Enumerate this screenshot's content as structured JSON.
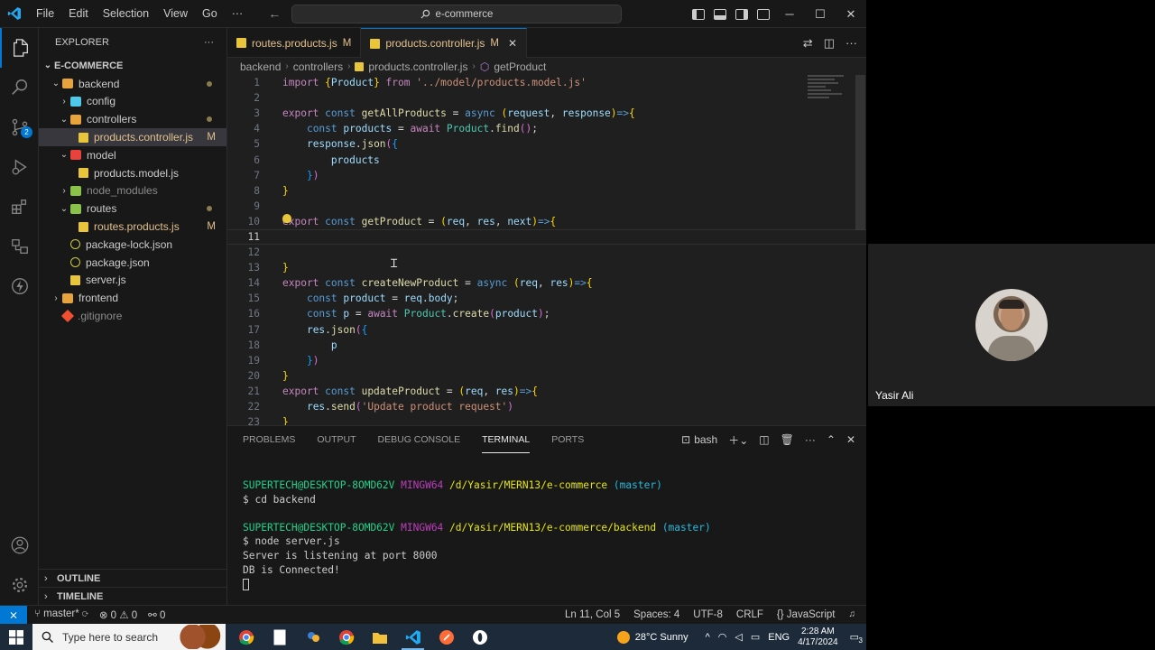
{
  "titlebar": {
    "menu": [
      "File",
      "Edit",
      "Selection",
      "View",
      "Go",
      "···"
    ],
    "search": "e-commerce",
    "back": "←",
    "forward": "→",
    "minimize": "─",
    "maximize": "☐",
    "close": "✕"
  },
  "activitybar": {
    "items": [
      "explorer-icon",
      "search-icon",
      "source-control-icon",
      "run-debug-icon",
      "extensions-icon",
      "remote-explorer-icon",
      "thunder-client-icon"
    ],
    "scm_badge": "2"
  },
  "explorer": {
    "title": "EXPLORER",
    "more": "···",
    "root": "E-COMMERCE",
    "tree": [
      {
        "label": "backend",
        "indent": 1,
        "type": "folder-open",
        "color": "#e8a33d",
        "dot": true
      },
      {
        "label": "config",
        "indent": 2,
        "type": "folder",
        "color": "#4ec9e9"
      },
      {
        "label": "controllers",
        "indent": 2,
        "type": "folder-open",
        "color": "#e8a33d",
        "dot": true
      },
      {
        "label": "products.controller.js",
        "indent": 3,
        "type": "js",
        "status": "M",
        "selected": true
      },
      {
        "label": "model",
        "indent": 2,
        "type": "folder-open",
        "color": "#e8423d"
      },
      {
        "label": "products.model.js",
        "indent": 3,
        "type": "js"
      },
      {
        "label": "node_modules",
        "indent": 2,
        "type": "folder",
        "color": "#8bc34a",
        "dim": true
      },
      {
        "label": "routes",
        "indent": 2,
        "type": "folder-open",
        "color": "#8bc34a",
        "dot": true
      },
      {
        "label": "routes.products.js",
        "indent": 3,
        "type": "js",
        "status": "M"
      },
      {
        "label": "package-lock.json",
        "indent": 2,
        "type": "json"
      },
      {
        "label": "package.json",
        "indent": 2,
        "type": "json"
      },
      {
        "label": "server.js",
        "indent": 2,
        "type": "js"
      },
      {
        "label": "frontend",
        "indent": 1,
        "type": "folder",
        "color": "#e8a33d"
      },
      {
        "label": ".gitignore",
        "indent": 1,
        "type": "git"
      }
    ],
    "outline": "OUTLINE",
    "timeline": "TIMELINE"
  },
  "tabs": [
    {
      "label": "routes.products.js",
      "status": "M",
      "active": false
    },
    {
      "label": "products.controller.js",
      "status": "M",
      "active": true,
      "close": "✕"
    }
  ],
  "breadcrumb": [
    "backend",
    "controllers",
    "products.controller.js",
    "getProduct"
  ],
  "code": {
    "current_line": 11,
    "lines": [
      [
        [
          "kw-ctrl",
          "import "
        ],
        [
          "br1",
          "{"
        ],
        [
          "var",
          "Product"
        ],
        [
          "br1",
          "}"
        ],
        [
          "ctrl",
          " from "
        ],
        [
          "str",
          "'../model/products.model.js'"
        ]
      ],
      [],
      [
        [
          "ctrl",
          "export "
        ],
        [
          "kw",
          "const "
        ],
        [
          "fn",
          "getAllProducts"
        ],
        [
          "pun",
          " = "
        ],
        [
          "kw",
          "async "
        ],
        [
          "br1",
          "("
        ],
        [
          "var",
          "request"
        ],
        [
          "pun",
          ", "
        ],
        [
          "var",
          "response"
        ],
        [
          "br1",
          ")"
        ],
        [
          "arrow",
          "=>"
        ],
        [
          "br1",
          "{"
        ]
      ],
      [
        [
          "pun",
          "    "
        ],
        [
          "kw",
          "const "
        ],
        [
          "var",
          "products"
        ],
        [
          "pun",
          " = "
        ],
        [
          "ctrl",
          "await "
        ],
        [
          "cls",
          "Product"
        ],
        [
          "pun",
          "."
        ],
        [
          "fn",
          "find"
        ],
        [
          "br2",
          "()"
        ],
        [
          "pun",
          ";"
        ]
      ],
      [
        [
          "pun",
          "    "
        ],
        [
          "var",
          "response"
        ],
        [
          "pun",
          "."
        ],
        [
          "fn",
          "json"
        ],
        [
          "br2",
          "("
        ],
        [
          "br3",
          "{"
        ]
      ],
      [
        [
          "pun",
          "        "
        ],
        [
          "var",
          "products"
        ]
      ],
      [
        [
          "pun",
          "    "
        ],
        [
          "br3",
          "}"
        ],
        [
          "br2",
          ")"
        ]
      ],
      [
        [
          "br1",
          "}"
        ]
      ],
      [],
      [
        [
          "ctrl",
          "export "
        ],
        [
          "kw",
          "const "
        ],
        [
          "fn",
          "getProduct"
        ],
        [
          "pun",
          " = "
        ],
        [
          "br1",
          "("
        ],
        [
          "var",
          "req"
        ],
        [
          "pun",
          ", "
        ],
        [
          "var",
          "res"
        ],
        [
          "pun",
          ", "
        ],
        [
          "var",
          "next"
        ],
        [
          "br1",
          ")"
        ],
        [
          "arrow",
          "=>"
        ],
        [
          "br1",
          "{"
        ]
      ],
      [],
      [],
      [
        [
          "br1",
          "}"
        ]
      ],
      [
        [
          "ctrl",
          "export "
        ],
        [
          "kw",
          "const "
        ],
        [
          "fn",
          "createNewProduct"
        ],
        [
          "pun",
          " = "
        ],
        [
          "kw",
          "async "
        ],
        [
          "br1",
          "("
        ],
        [
          "var",
          "req"
        ],
        [
          "pun",
          ", "
        ],
        [
          "var",
          "res"
        ],
        [
          "br1",
          ")"
        ],
        [
          "arrow",
          "=>"
        ],
        [
          "br1",
          "{"
        ]
      ],
      [
        [
          "pun",
          "    "
        ],
        [
          "kw",
          "const "
        ],
        [
          "var",
          "product"
        ],
        [
          "pun",
          " = "
        ],
        [
          "var",
          "req"
        ],
        [
          "pun",
          "."
        ],
        [
          "var",
          "body"
        ],
        [
          "pun",
          ";"
        ]
      ],
      [
        [
          "pun",
          "    "
        ],
        [
          "kw",
          "const "
        ],
        [
          "var",
          "p"
        ],
        [
          "pun",
          " = "
        ],
        [
          "ctrl",
          "await "
        ],
        [
          "cls",
          "Product"
        ],
        [
          "pun",
          "."
        ],
        [
          "fn",
          "create"
        ],
        [
          "br2",
          "("
        ],
        [
          "var",
          "product"
        ],
        [
          "br2",
          ")"
        ],
        [
          "pun",
          ";"
        ]
      ],
      [
        [
          "pun",
          "    "
        ],
        [
          "var",
          "res"
        ],
        [
          "pun",
          "."
        ],
        [
          "fn",
          "json"
        ],
        [
          "br2",
          "("
        ],
        [
          "br3",
          "{"
        ]
      ],
      [
        [
          "pun",
          "        "
        ],
        [
          "var",
          "p"
        ]
      ],
      [
        [
          "pun",
          "    "
        ],
        [
          "br3",
          "}"
        ],
        [
          "br2",
          ")"
        ]
      ],
      [
        [
          "br1",
          "}"
        ]
      ],
      [
        [
          "ctrl",
          "export "
        ],
        [
          "kw",
          "const "
        ],
        [
          "fn",
          "updateProduct"
        ],
        [
          "pun",
          " = "
        ],
        [
          "br1",
          "("
        ],
        [
          "var",
          "req"
        ],
        [
          "pun",
          ", "
        ],
        [
          "var",
          "res"
        ],
        [
          "br1",
          ")"
        ],
        [
          "arrow",
          "=>"
        ],
        [
          "br1",
          "{"
        ]
      ],
      [
        [
          "pun",
          "    "
        ],
        [
          "var",
          "res"
        ],
        [
          "pun",
          "."
        ],
        [
          "fn",
          "send"
        ],
        [
          "br2",
          "("
        ],
        [
          "str",
          "'Update product request'"
        ],
        [
          "br2",
          ")"
        ]
      ],
      [
        [
          "br1",
          "}"
        ]
      ]
    ]
  },
  "panel": {
    "tabs": [
      "PROBLEMS",
      "OUTPUT",
      "DEBUG CONSOLE",
      "TERMINAL",
      "PORTS"
    ],
    "active_tab": "TERMINAL",
    "shell": "bash",
    "terminal": [
      {
        "user": "SUPERTECH@DESKTOP-8OMD62V",
        "host": "MINGW64",
        "path": "/d/Yasir/MERN13/e-commerce",
        "branch": "(master)"
      },
      {
        "cmd": "$ cd backend"
      },
      {
        "blank": true
      },
      {
        "user": "SUPERTECH@DESKTOP-8OMD62V",
        "host": "MINGW64",
        "path": "/d/Yasir/MERN13/e-commerce/backend",
        "branch": "(master)"
      },
      {
        "cmd": "$ node server.js"
      },
      {
        "out": "Server is listening at port 8000"
      },
      {
        "out": "DB is Connected!"
      }
    ]
  },
  "statusbar": {
    "remote": "⨯",
    "branch": "master*",
    "sync": "⟳",
    "errors": "⊗ 0 ⚠ 0",
    "ports": "⚯ 0",
    "position": "Ln 11, Col 5",
    "spaces": "Spaces: 4",
    "encoding": "UTF-8",
    "eol": "CRLF",
    "language": "{} JavaScript",
    "bell": "🔔"
  },
  "webcam": {
    "name": "Yasir Ali"
  },
  "taskbar": {
    "search_placeholder": "Type here to search",
    "weather": "28°C  Sunny",
    "lang": "ENG",
    "time": "2:28 AM",
    "date": "4/17/2024",
    "notif_count": "3"
  }
}
